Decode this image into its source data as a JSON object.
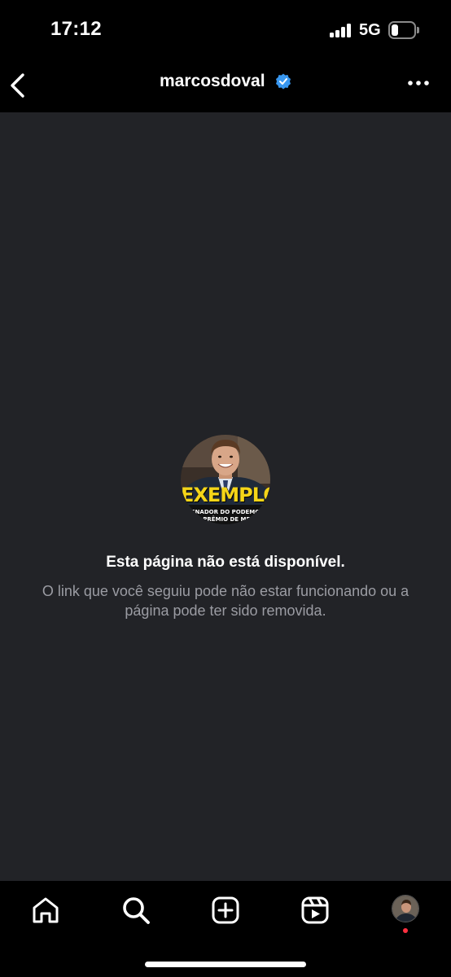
{
  "status_bar": {
    "time": "17:12",
    "network": "5G",
    "signal_bars": 4,
    "battery_level": 0.3
  },
  "header": {
    "username": "marcosdoval",
    "verified": true,
    "verified_color": "#3897f0",
    "back_icon": "chevron-left-icon",
    "more_icon": "ellipsis-icon"
  },
  "content": {
    "avatar_image": {
      "headline": "EXEMPLO",
      "line1": "SENADOR DO PODEMOS",
      "line2": "... PRÊMIO DE ME..."
    },
    "title": "Esta página não está disponível.",
    "description": "O link que você seguiu pode não estar funcionando ou a página pode ter sido removida.",
    "background_color": "#222327"
  },
  "bottom_nav": {
    "items": [
      {
        "icon": "home-icon"
      },
      {
        "icon": "search-icon"
      },
      {
        "icon": "create-icon"
      },
      {
        "icon": "reels-icon"
      },
      {
        "icon": "profile-avatar"
      }
    ],
    "notification_dot_color": "#ff3040"
  }
}
